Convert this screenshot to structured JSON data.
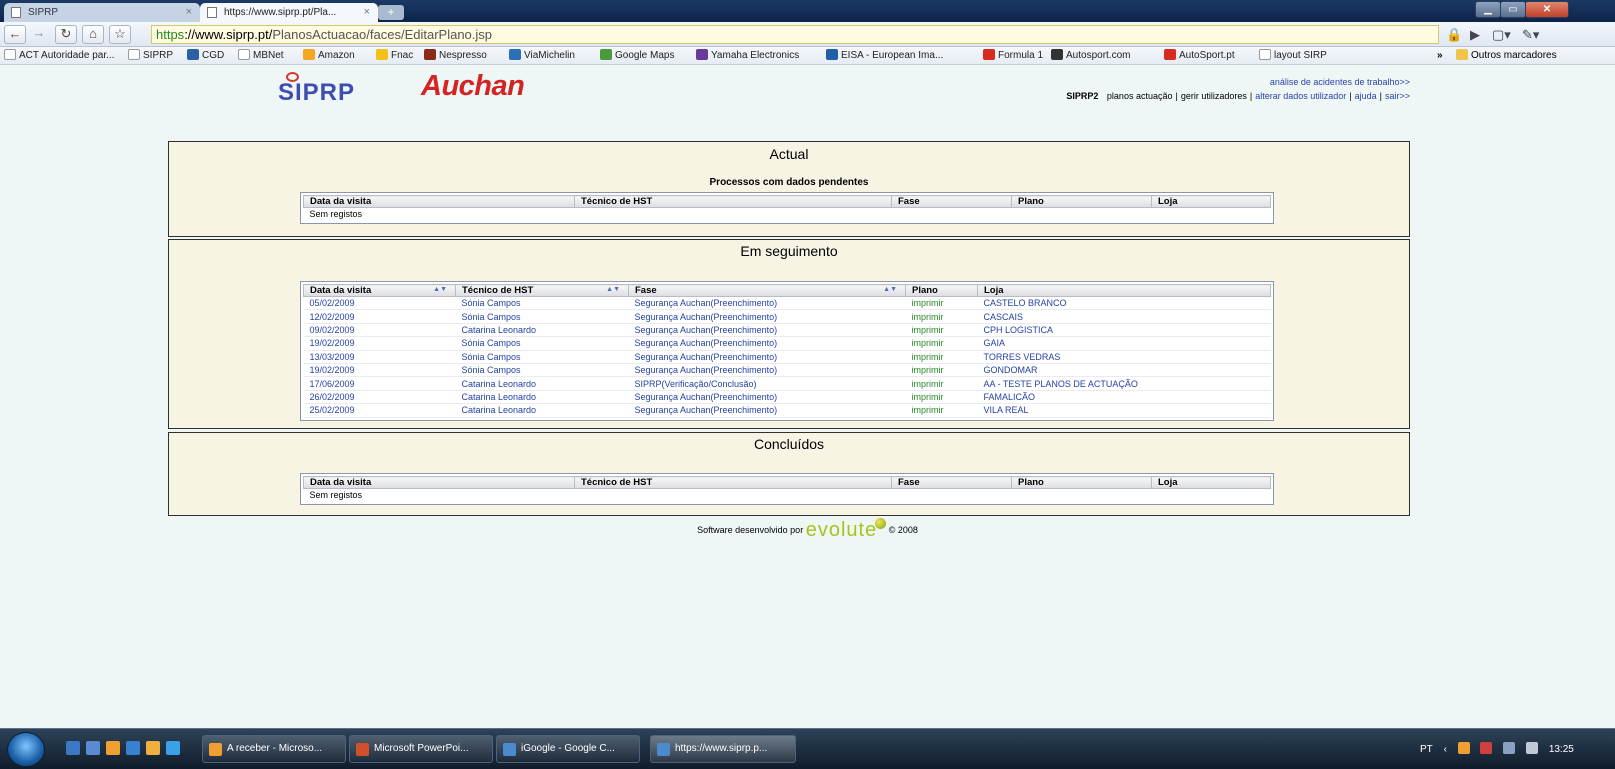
{
  "browser": {
    "tabs": [
      {
        "label": "SIPRP",
        "active": false
      },
      {
        "label": "https://www.siprp.pt/Pla...",
        "active": true
      }
    ],
    "new_tab": "+",
    "url": {
      "secure": "https",
      "host": "://www.siprp.pt/",
      "path": "PlanosActuacao/faces/EditarPlano.jsp"
    },
    "bookmarks": [
      {
        "label": "ACT Autoridade par...",
        "color": "#ffffff"
      },
      {
        "label": "SIPRP",
        "color": "#ffffff"
      },
      {
        "label": "CGD",
        "color": "#2d5fa6"
      },
      {
        "label": "MBNet",
        "color": "#ffffff"
      },
      {
        "label": "Amazon",
        "color": "#f5a623"
      },
      {
        "label": "Fnac",
        "color": "#f3c11a"
      },
      {
        "label": "Nespresso",
        "color": "#8a2a1a"
      },
      {
        "label": "ViaMichelin",
        "color": "#2d6fb7"
      },
      {
        "label": "Google Maps",
        "color": "#4b9a3c"
      },
      {
        "label": "Yamaha Electronics",
        "color": "#6a3a9a"
      },
      {
        "label": "EISA - European Ima...",
        "color": "#1e5fa8"
      },
      {
        "label": "Formula 1",
        "color": "#d82b1f"
      },
      {
        "label": "Autosport.com",
        "color": "#333333"
      },
      {
        "label": "AutoSport.pt",
        "color": "#d82b1f"
      },
      {
        "label": "layout SIRP",
        "color": "#ffffff"
      }
    ],
    "bookmarks_more": "»",
    "other_bookmarks": "Outros marcadores"
  },
  "header": {
    "logo_siprp": "SIPRP",
    "logo_auchan": "Auchan",
    "top_link": "análise de acidentes de trabalho>>",
    "brand": "SIPRP2",
    "nav": [
      {
        "label": "planos actuação",
        "blue": false
      },
      {
        "label": "gerir utilizadores",
        "blue": false
      },
      {
        "label": "alterar dados utilizador",
        "blue": true
      },
      {
        "label": "ajuda",
        "blue": true
      },
      {
        "label": "sair>>",
        "blue": true
      }
    ]
  },
  "columns": [
    "Data da visita",
    "Técnico de HST",
    "Fase",
    "Plano",
    "Loja"
  ],
  "actual": {
    "title": "Actual",
    "subtitle": "Processos com dados pendentes",
    "empty_text": "Sem registos"
  },
  "seguimento": {
    "title": "Em seguimento",
    "rows": [
      {
        "data": "05/02/2009",
        "tecnico": "Sónia Campos",
        "fase": "Segurança Auchan(Preenchimento)",
        "plano": "imprimir",
        "loja": "CASTELO BRANCO"
      },
      {
        "data": "12/02/2009",
        "tecnico": "Sónia Campos",
        "fase": "Segurança Auchan(Preenchimento)",
        "plano": "imprimir",
        "loja": "CASCAIS"
      },
      {
        "data": "09/02/2009",
        "tecnico": "Catarina Leonardo",
        "fase": "Segurança Auchan(Preenchimento)",
        "plano": "imprimir",
        "loja": "CPH LOGISTICA"
      },
      {
        "data": "19/02/2009",
        "tecnico": "Sónia Campos",
        "fase": "Segurança Auchan(Preenchimento)",
        "plano": "imprimir",
        "loja": "GAIA"
      },
      {
        "data": "13/03/2009",
        "tecnico": "Sónia Campos",
        "fase": "Segurança Auchan(Preenchimento)",
        "plano": "imprimir",
        "loja": "TORRES VEDRAS"
      },
      {
        "data": "19/02/2009",
        "tecnico": "Sónia Campos",
        "fase": "Segurança Auchan(Preenchimento)",
        "plano": "imprimir",
        "loja": "GONDOMAR"
      },
      {
        "data": "17/06/2009",
        "tecnico": "Catarina Leonardo",
        "fase": "SIPRP(Verificação/Conclusão)",
        "plano": "imprimir",
        "loja": "AA - TESTE PLANOS DE ACTUAÇÃO"
      },
      {
        "data": "26/02/2009",
        "tecnico": "Catarina Leonardo",
        "fase": "Segurança Auchan(Preenchimento)",
        "plano": "imprimir",
        "loja": "FAMALICÃO"
      },
      {
        "data": "25/02/2009",
        "tecnico": "Catarina Leonardo",
        "fase": "Segurança Auchan(Preenchimento)",
        "plano": "imprimir",
        "loja": "VILA REAL"
      }
    ]
  },
  "concluidos": {
    "title": "Concluídos",
    "empty_text": "Sem registos"
  },
  "footer": {
    "prefix": "Software desenvolvido por",
    "brand": "evolute",
    "suffix": "© 2008"
  },
  "taskbar": {
    "buttons": [
      {
        "label": "A receber - Microso...",
        "color": "#f0a030"
      },
      {
        "label": "Microsoft PowerPoi...",
        "color": "#d0502a"
      },
      {
        "label": "iGoogle - Google C...",
        "color": "#4a8ad0"
      },
      {
        "label": "https://www.siprp.p...",
        "color": "#4a8ad0"
      }
    ],
    "lang": "PT",
    "clock": "13:25"
  }
}
